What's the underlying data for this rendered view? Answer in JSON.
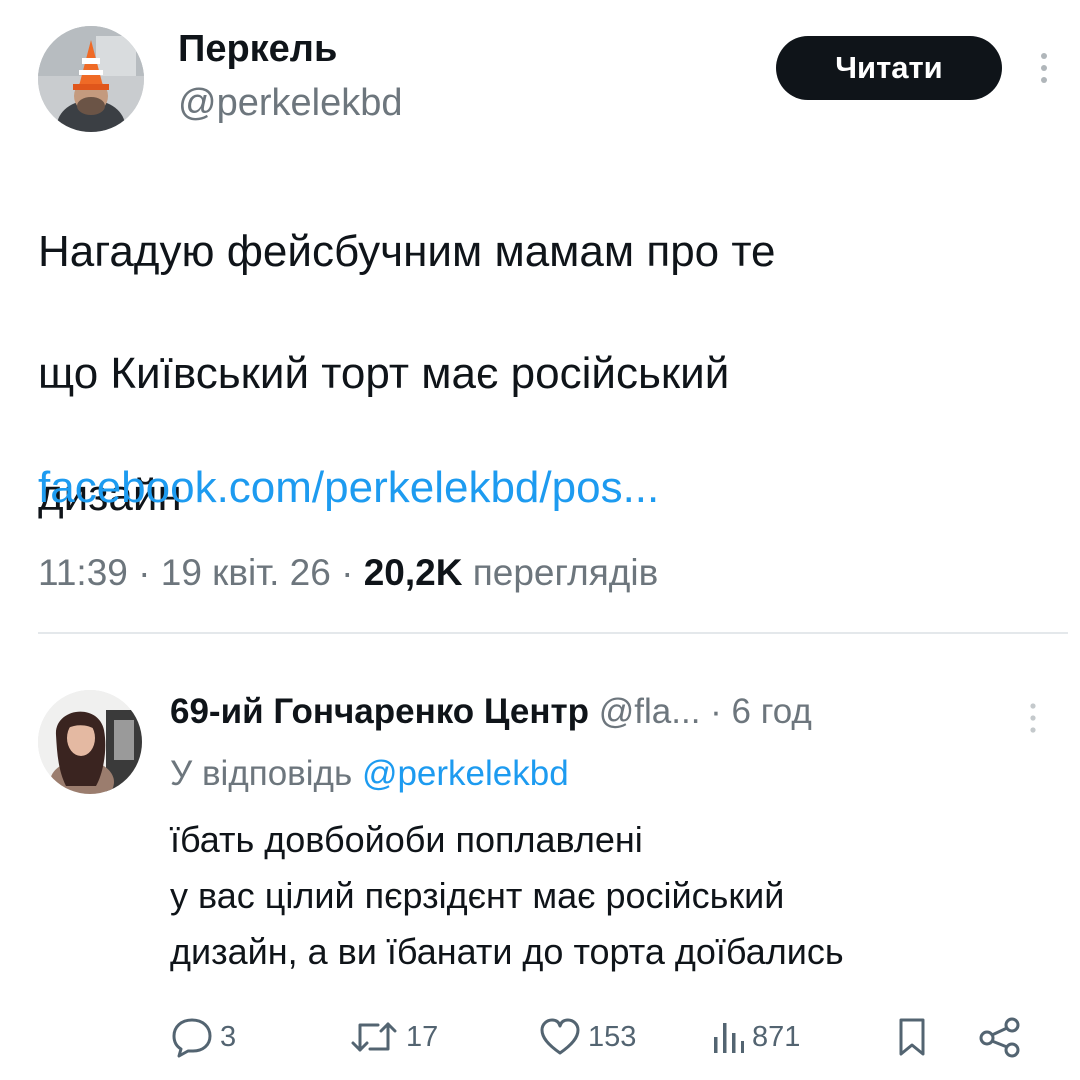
{
  "tweet": {
    "author_name": "Перкель",
    "author_handle": "@perkelekbd",
    "follow_label": "Читати",
    "text_lines": [
      "Нагадую фейсбучним мамам про те",
      "що Київський торт має російський",
      "дизайн"
    ],
    "link": "facebook.com/perkelekbd/pos...",
    "time": "11:39",
    "date": "19 квіт. 26",
    "views_count": "20,2K",
    "views_label": "переглядів",
    "separator": "·",
    "more_icon": "more-vertical-icon"
  },
  "reply": {
    "author_name": "69-ий Гончаренко Центр",
    "author_handle": "@fla...",
    "time_ago": "6 год",
    "reply_to_label": "У відповідь",
    "reply_to_handle": "@perkelekbd",
    "text_lines": [
      "їбать довбойоби поплавлені",
      "у вас цілий пєрзідєнт має російський",
      "дизайн, а ви їбанати до торта доїбались"
    ],
    "actions": {
      "replies": "3",
      "retweets": "17",
      "likes": "153",
      "views": "871"
    }
  },
  "colors": {
    "text": "#0f1419",
    "secondary": "#6d767d",
    "link": "#1d9bf0",
    "button_bg": "#0f1419",
    "button_text": "#ffffff",
    "divider": "#e4e8eb"
  }
}
